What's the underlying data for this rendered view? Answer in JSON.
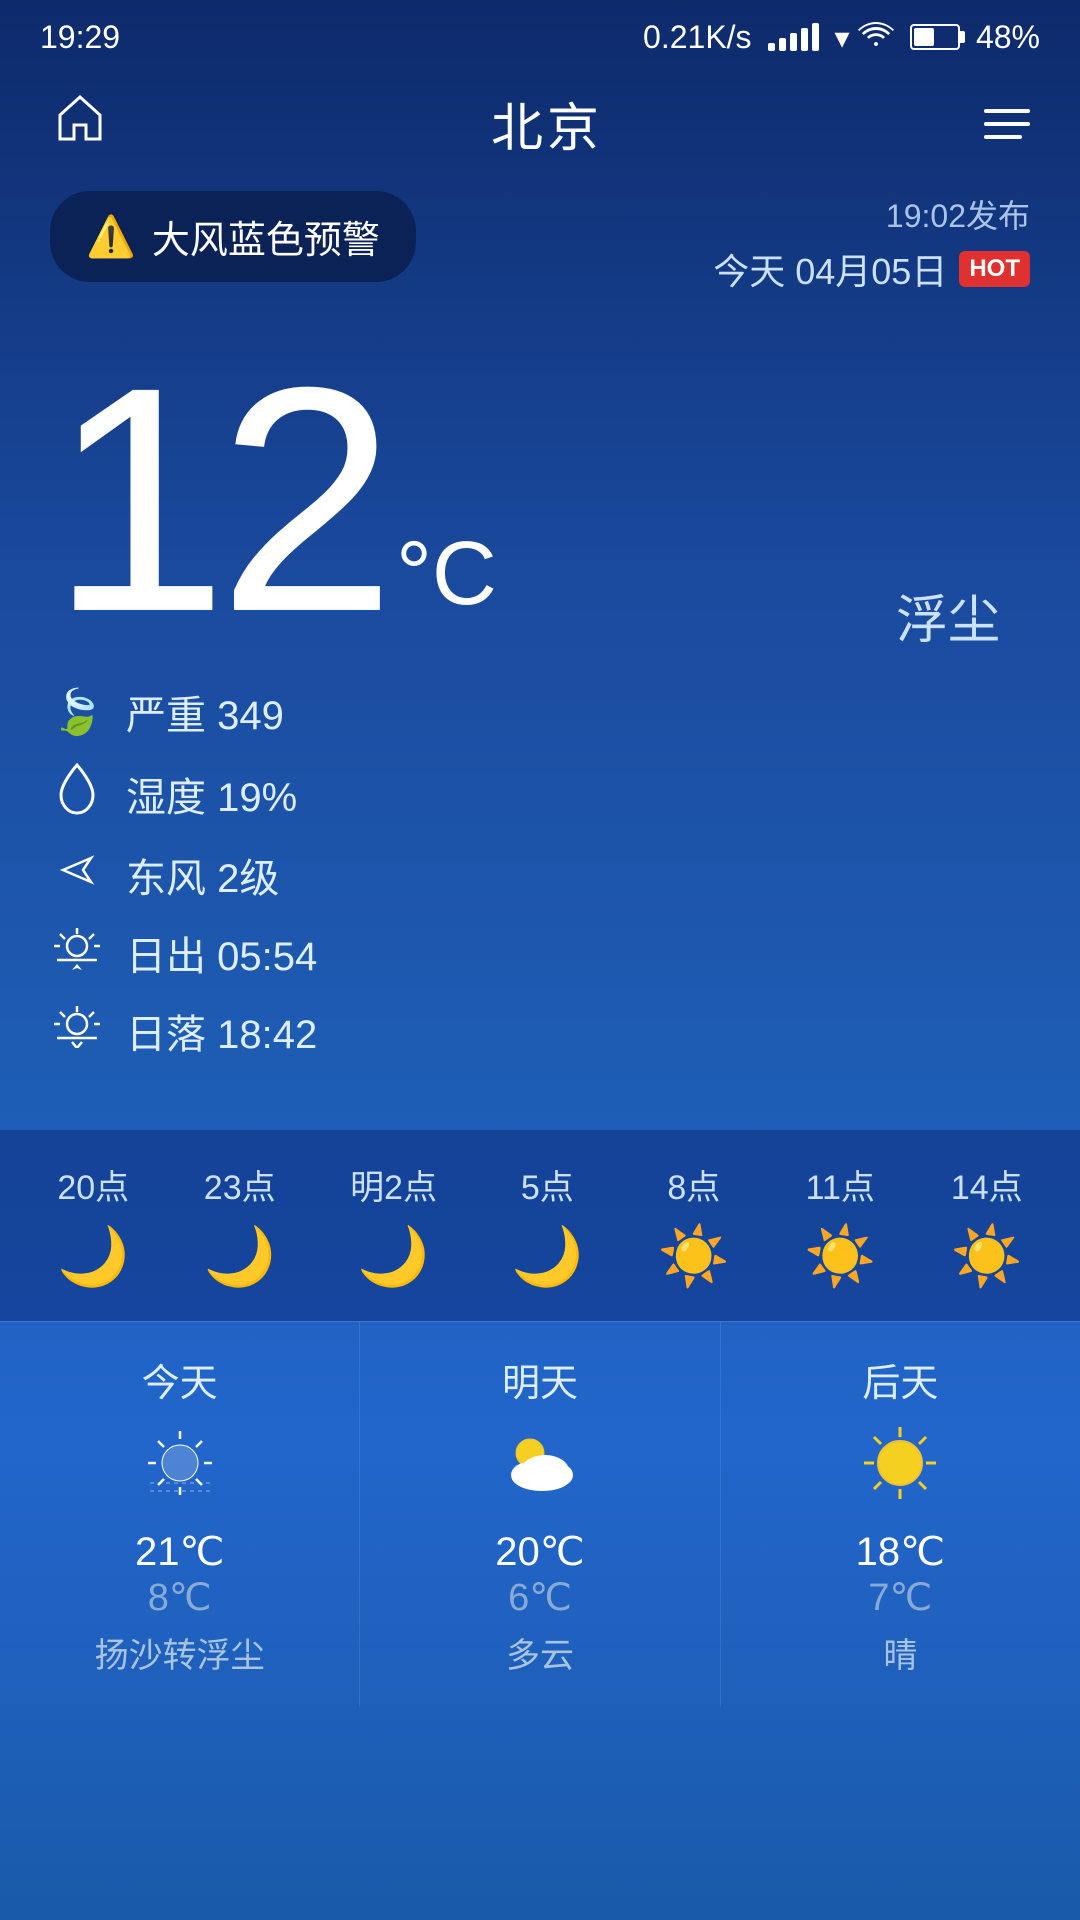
{
  "statusBar": {
    "time": "19:29",
    "network": "0.21K/s",
    "battery": "48%"
  },
  "nav": {
    "city": "北京",
    "homeIconLabel": "home",
    "menuIconLabel": "menu"
  },
  "alert": {
    "badge": "大风蓝色预警",
    "publishTime": "19:02发布",
    "date": "今天 04月05日",
    "hotLabel": "HOT"
  },
  "current": {
    "temperature": "12",
    "unit": "°C",
    "description": "浮尘"
  },
  "details": {
    "airQuality": "严重 349",
    "humidity": "湿度 19%",
    "wind": "东风 2级",
    "sunrise": "日出  05:54",
    "sunset": "日落  18:42"
  },
  "hourly": [
    {
      "time": "20点",
      "iconType": "moon"
    },
    {
      "time": "23点",
      "iconType": "moon"
    },
    {
      "time": "明2点",
      "iconType": "moon"
    },
    {
      "time": "5点",
      "iconType": "moon"
    },
    {
      "time": "8点",
      "iconType": "sun"
    },
    {
      "time": "11点",
      "iconType": "sun"
    },
    {
      "time": "14点",
      "iconType": "sun"
    }
  ],
  "forecast": [
    {
      "day": "今天",
      "iconType": "haze",
      "high": "21℃",
      "low": "8℃",
      "desc": "扬沙转浮尘"
    },
    {
      "day": "明天",
      "iconType": "partlyCloudy",
      "high": "20℃",
      "low": "6℃",
      "desc": "多云"
    },
    {
      "day": "后天",
      "iconType": "sunny",
      "high": "18℃",
      "low": "7℃",
      "desc": "晴"
    }
  ]
}
